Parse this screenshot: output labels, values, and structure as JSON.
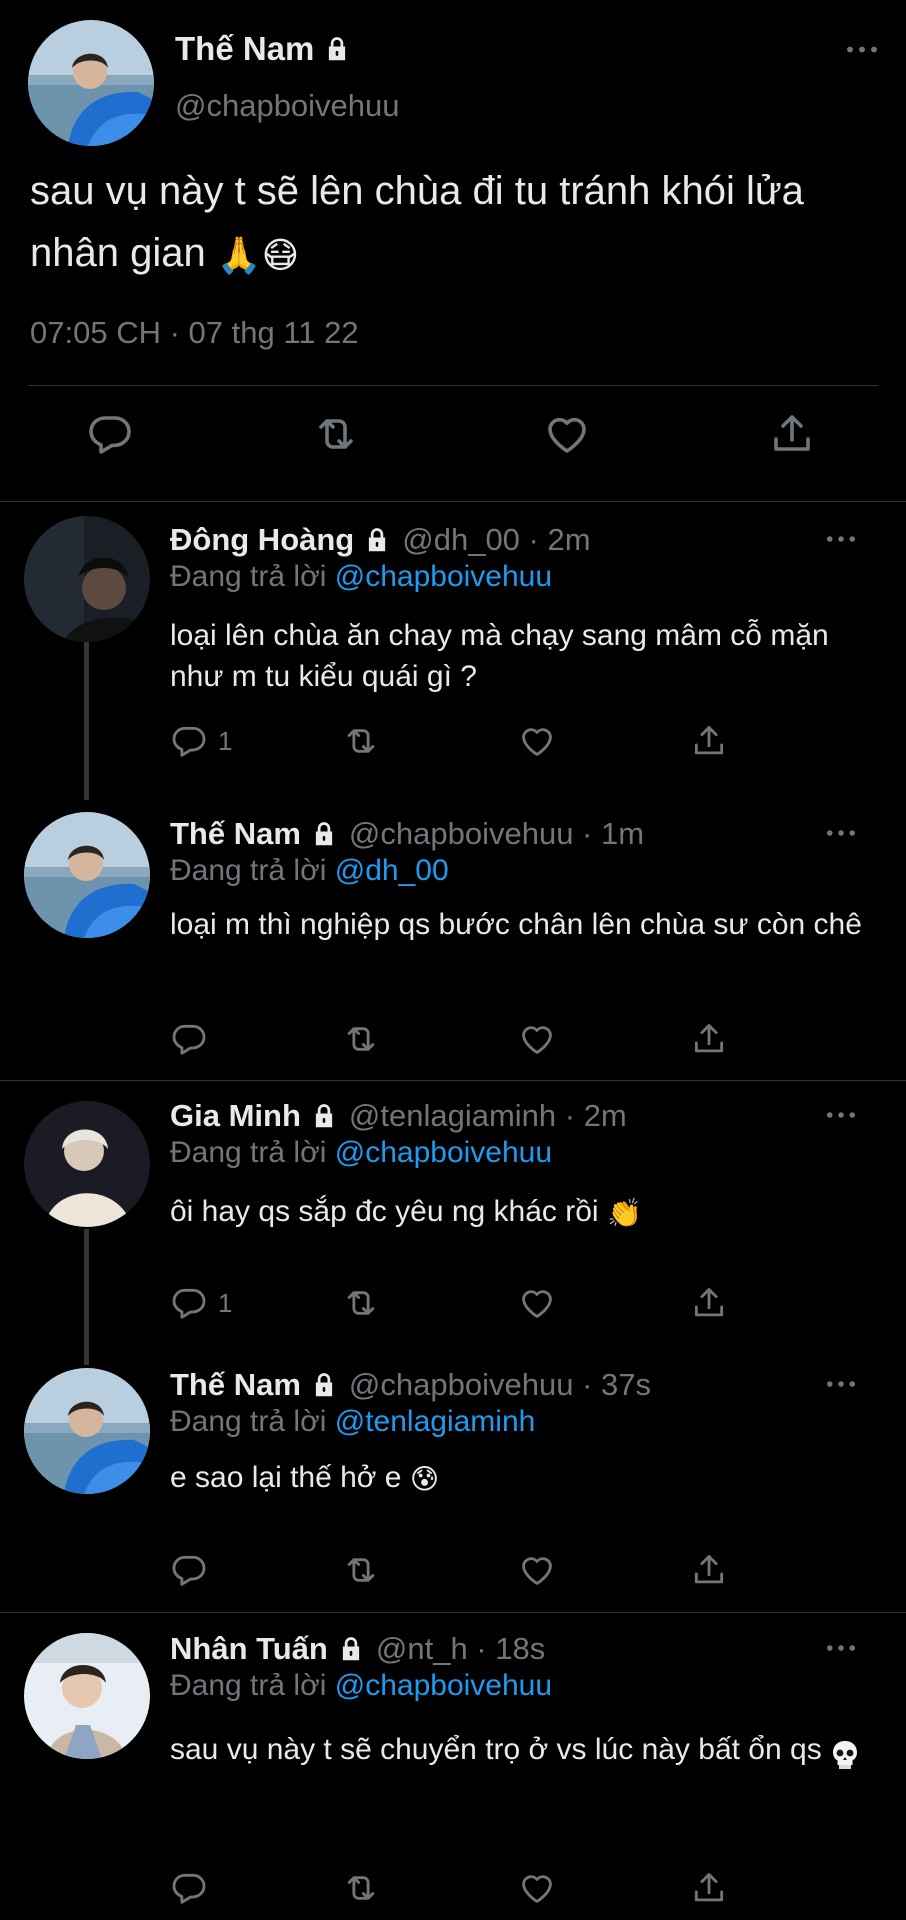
{
  "main_tweet": {
    "name": "Thế Nam",
    "handle": "@chapboivehuu",
    "text": "sau vụ này t sẽ lên chùa đi tu tránh khói lửa nhân gian",
    "emojis": "🙏😷",
    "timestamp": "07:05 CH · 07 thg 11 22",
    "icons": [
      "reply-icon",
      "retweet-icon",
      "like-icon",
      "share-icon",
      "lock-icon",
      "more-icon"
    ]
  },
  "replies": [
    {
      "name": "Đông Hoàng",
      "meta": "@dh_00 · 2m",
      "replying_prefix": "Đang trả lời",
      "mention": "@chapboivehuu",
      "text": "loại lên chùa ăn chay mà chạy sang mâm cỗ mặn như m tu kiểu quái gì ?",
      "reply_count": "1"
    },
    {
      "name": "Thế Nam",
      "meta": "@chapboivehuu · 1m",
      "replying_prefix": "Đang trả lời",
      "mention": "@dh_00",
      "text": "loại m thì nghiệp qs bước chân lên chùa sư còn chê",
      "reply_count": ""
    },
    {
      "name": "Gia Minh",
      "meta": "@tenlagiaminh · 2m",
      "replying_prefix": "Đang trả lời",
      "mention": "@chapboivehuu",
      "text": "ôi hay qs sắp đc yêu ng khác rồi",
      "emoji": "👏",
      "reply_count": "1"
    },
    {
      "name": "Thế Nam",
      "meta": "@chapboivehuu · 37s",
      "replying_prefix": "Đang trả lời",
      "mention": "@tenlagiaminh",
      "text": "e sao lại thế hở e",
      "emoji": "😰",
      "reply_count": ""
    },
    {
      "name": "Nhân Tuấn",
      "meta": "@nt_h · 18s",
      "replying_prefix": "Đang trả lời",
      "mention": "@chapboivehuu",
      "text": "sau vụ này t sẽ chuyển trọ ở vs lúc này bất ổn qs",
      "emoji": "skull",
      "reply_count": ""
    }
  ],
  "colors": {
    "background": "#000000",
    "text": "#e7e9ea",
    "secondary": "#71767b",
    "mention": "#1d9bf0",
    "divider": "#2f3336"
  }
}
